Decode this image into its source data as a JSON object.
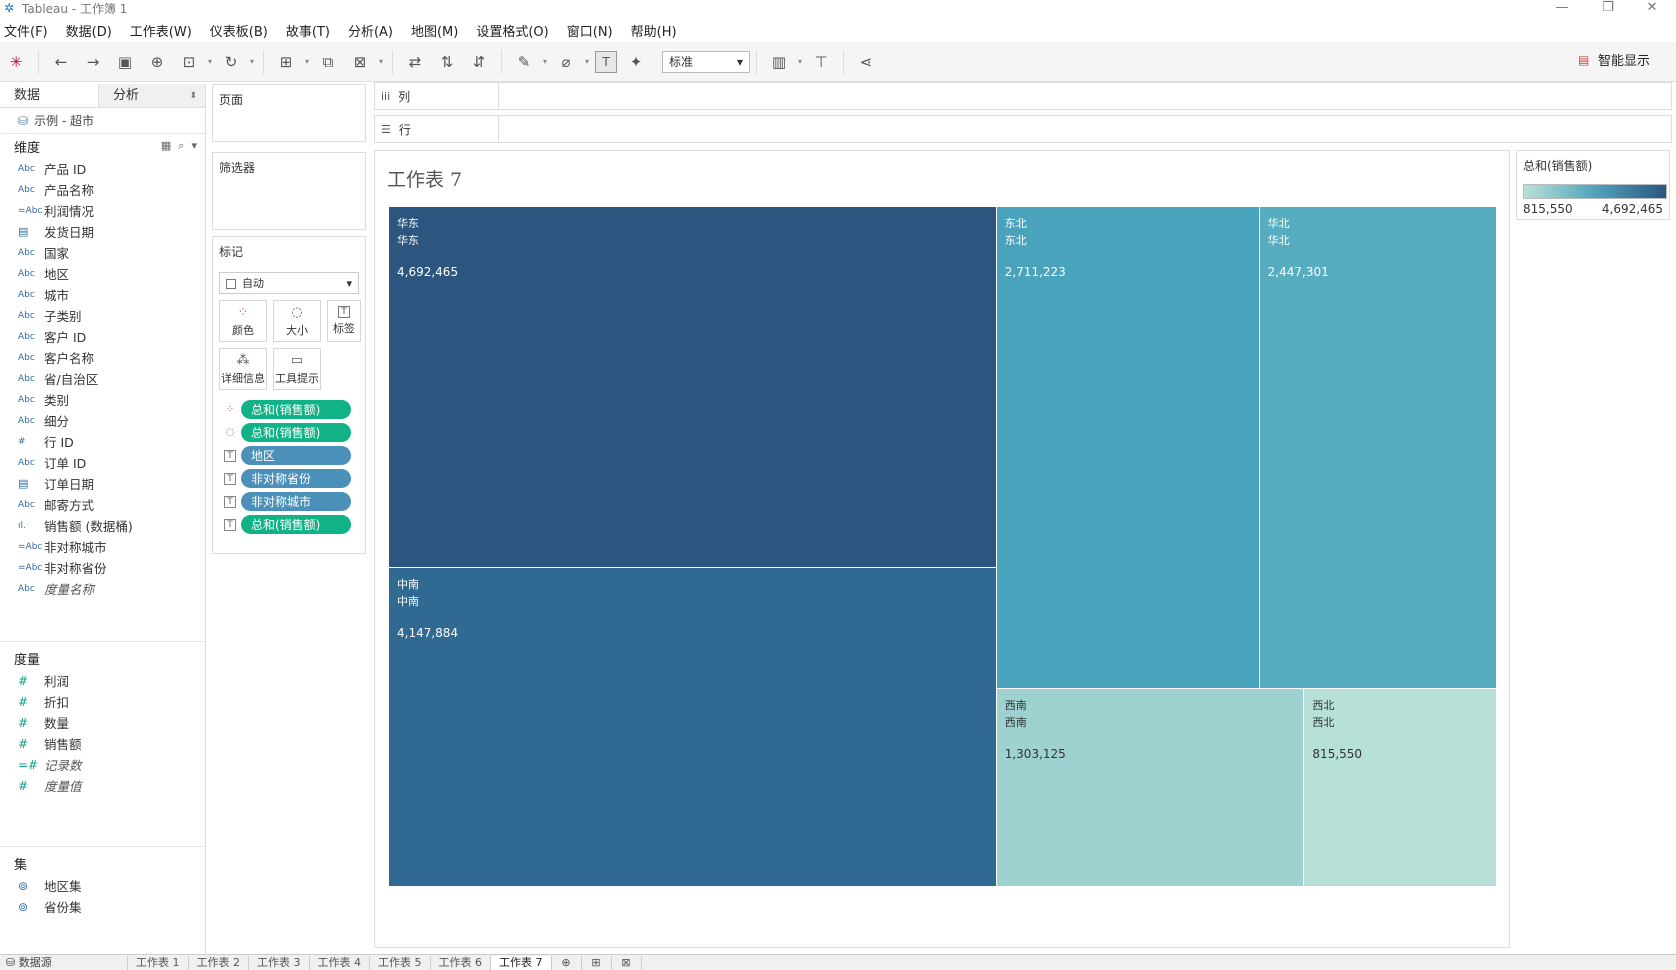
{
  "window": {
    "title": "Tableau - 工作簿 1",
    "minimize": "—",
    "restore": "❐",
    "close": "✕"
  },
  "menu": [
    "文件(F)",
    "数据(D)",
    "工作表(W)",
    "仪表板(B)",
    "故事(T)",
    "分析(A)",
    "地图(M)",
    "设置格式(O)",
    "窗口(N)",
    "帮助(H)"
  ],
  "toolbar": {
    "fit_select": "标准",
    "show_me": "智能显示"
  },
  "data_pane": {
    "tab_data": "数据",
    "tab_analysis": "分析",
    "datasource": "示例 - 超市",
    "dimensions_header": "维度",
    "dimensions": [
      {
        "type": "Abc",
        "name": "产品 ID"
      },
      {
        "type": "Abc",
        "name": "产品名称"
      },
      {
        "type": "=Abc",
        "name": "利润情况"
      },
      {
        "type": "date",
        "name": "发货日期"
      },
      {
        "type": "Abc",
        "name": "国家"
      },
      {
        "type": "Abc",
        "name": "地区"
      },
      {
        "type": "Abc",
        "name": "城市"
      },
      {
        "type": "Abc",
        "name": "子类别"
      },
      {
        "type": "Abc",
        "name": "客户 ID"
      },
      {
        "type": "Abc",
        "name": "客户名称"
      },
      {
        "type": "Abc",
        "name": "省/自治区"
      },
      {
        "type": "Abc",
        "name": "类别"
      },
      {
        "type": "Abc",
        "name": "细分"
      },
      {
        "type": "#",
        "name": "行 ID"
      },
      {
        "type": "Abc",
        "name": "订单 ID"
      },
      {
        "type": "date",
        "name": "订单日期"
      },
      {
        "type": "Abc",
        "name": "邮寄方式"
      },
      {
        "type": "bin",
        "name": "销售额 (数据桶)"
      },
      {
        "type": "=Abc",
        "name": "非对称城市"
      },
      {
        "type": "=Abc",
        "name": "非对称省份"
      },
      {
        "type": "Abc",
        "name": "度量名称",
        "italic": true
      }
    ],
    "measures_header": "度量",
    "measures": [
      {
        "type": "#",
        "name": "利润"
      },
      {
        "type": "#",
        "name": "折扣"
      },
      {
        "type": "#",
        "name": "数量"
      },
      {
        "type": "#",
        "name": "销售额"
      },
      {
        "type": "=#",
        "name": "记录数",
        "italic": true
      },
      {
        "type": "#",
        "name": "度量值",
        "italic": true
      }
    ],
    "sets_header": "集",
    "sets": [
      {
        "name": "地区集"
      },
      {
        "name": "省份集"
      }
    ]
  },
  "shelves": {
    "pages": "页面",
    "filters": "筛选器",
    "marks": "标记",
    "marks_type": "自动",
    "columns": "列",
    "rows": "行"
  },
  "marks_buttons": [
    {
      "label": "颜色",
      "icon": "color-icon"
    },
    {
      "label": "大小",
      "icon": "size-icon"
    },
    {
      "label": "标签",
      "icon": "label-icon"
    },
    {
      "label": "详细信息",
      "icon": "detail-icon"
    },
    {
      "label": "工具提示",
      "icon": "tooltip-icon"
    }
  ],
  "mark_pills": [
    {
      "icon": "color-icon",
      "label": "总和(销售额)",
      "color": "#11b386"
    },
    {
      "icon": "size-icon",
      "label": "总和(销售额)",
      "color": "#11b386"
    },
    {
      "icon": "label-icon",
      "label": "地区",
      "color": "#4a90b8"
    },
    {
      "icon": "label-icon",
      "label": "非对称省份",
      "color": "#4a90b8"
    },
    {
      "icon": "label-icon",
      "label": "非对称城市",
      "color": "#4a90b8"
    },
    {
      "icon": "label-icon",
      "label": "总和(销售额)",
      "color": "#11b386"
    }
  ],
  "sheet_title": "工作表 7",
  "chart_data": {
    "type": "treemap",
    "measure": "总和(销售额)",
    "items": [
      {
        "region": "华东",
        "label2": "华东",
        "value": 4692465,
        "display": "4,692,465",
        "color": "#2c567f"
      },
      {
        "region": "中南",
        "label2": "中南",
        "value": 4147884,
        "display": "4,147,884",
        "color": "#306a92"
      },
      {
        "region": "东北",
        "label2": "东北",
        "value": 2711223,
        "display": "2,711,223",
        "color": "#4aa3bc"
      },
      {
        "region": "华北",
        "label2": "华北",
        "value": 2447301,
        "display": "2,447,301",
        "color": "#57adc0"
      },
      {
        "region": "西南",
        "label2": "西南",
        "value": 1303125,
        "display": "1,303,125",
        "color": "#9dd2d0"
      },
      {
        "region": "西北",
        "label2": "西北",
        "value": 815550,
        "display": "815,550",
        "color": "#b6e0d8"
      }
    ]
  },
  "legend": {
    "title": "总和(销售额)",
    "min": "815,550",
    "max": "4,692,465"
  },
  "bottom_tabs": [
    "数据源",
    "工作表 1",
    "工作表 2",
    "工作表 3",
    "工作表 4",
    "工作表 5",
    "工作表 6",
    "工作表 7"
  ],
  "active_tab": "工作表 7"
}
